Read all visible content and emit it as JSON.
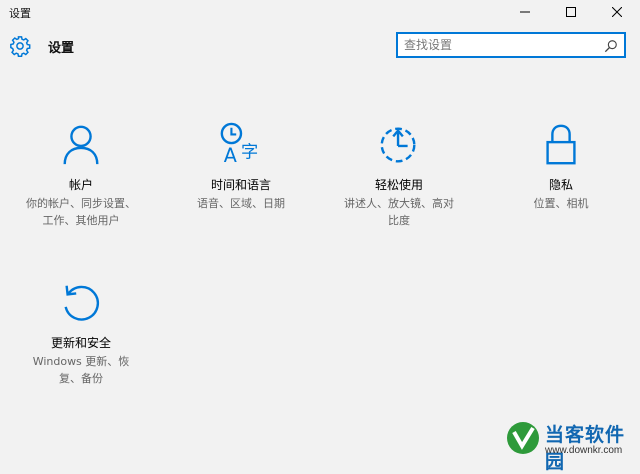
{
  "window": {
    "title": "设置"
  },
  "header": {
    "title": "设置"
  },
  "search": {
    "placeholder": "查找设置",
    "value": ""
  },
  "tiles": [
    {
      "label": "帐户",
      "desc1": "你的帐户、同步设置、",
      "desc2": "工作、其他用户",
      "icon": "person-icon"
    },
    {
      "label": "时间和语言",
      "desc1": "语音、区域、日期",
      "desc2": "",
      "icon": "time-language-icon"
    },
    {
      "label": "轻松使用",
      "desc1": "讲述人、放大镜、高对",
      "desc2": "比度",
      "icon": "ease-of-access-icon"
    },
    {
      "label": "隐私",
      "desc1": "位置、相机",
      "desc2": "",
      "icon": "lock-icon"
    },
    {
      "label": "更新和安全",
      "desc1": "Windows 更新、恢",
      "desc2": "复、备份",
      "icon": "refresh-icon"
    }
  ],
  "watermark": {
    "brand": "当客软件园",
    "url": "www.downkr.com"
  },
  "colors": {
    "accent": "#0078d7",
    "background": "#f2f2f2"
  }
}
